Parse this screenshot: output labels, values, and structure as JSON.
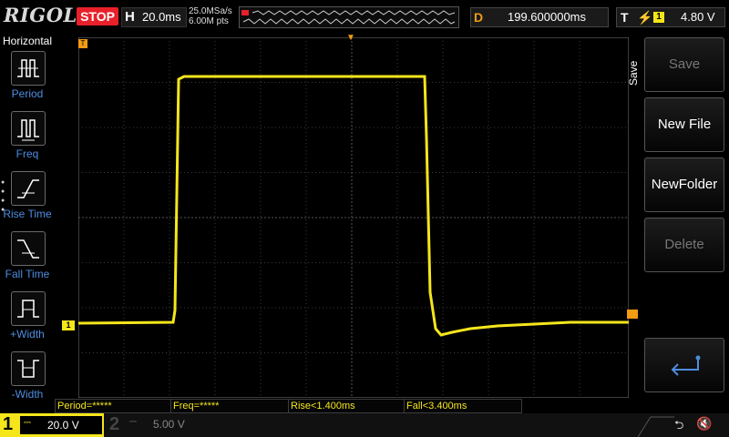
{
  "header": {
    "logo": "RIGOL",
    "run_status": "STOP",
    "timebase_letter": "H",
    "timebase": "20.0ms",
    "sample_rate": "25.0MSa/s",
    "memory_depth": "6.00M pts",
    "delay_letter": "D",
    "delay": "199.600000ms",
    "trigger_letter": "T",
    "trigger_channel": "1",
    "trigger_level": "4.80 V"
  },
  "left_menu": {
    "title": "Horizontal",
    "items": [
      {
        "label": "Period"
      },
      {
        "label": "Freq"
      },
      {
        "label": "Rise Time"
      },
      {
        "label": "Fall Time"
      },
      {
        "label": "+Width"
      },
      {
        "label": "-Width"
      }
    ],
    "dots": "●\n●\n●\n●"
  },
  "markers": {
    "trigger_position": "▼",
    "time_marker": "T",
    "channel1": "1"
  },
  "right_menu": {
    "title": "Save",
    "buttons": [
      {
        "label": "Save",
        "enabled": false
      },
      {
        "label": "New File",
        "enabled": true
      },
      {
        "label": "NewFolder",
        "enabled": true
      },
      {
        "label": "Delete",
        "enabled": false
      },
      {
        "label": "",
        "icon": "return-arrow-icon",
        "enabled": true
      }
    ]
  },
  "measurements": [
    {
      "text": "Period=*****"
    },
    {
      "text": "Freq=*****"
    },
    {
      "text": "Rise<1.400ms"
    },
    {
      "text": "Fall<3.400ms"
    }
  ],
  "bottom": {
    "ch1_number": "1",
    "ch1_scale": "20.0 V",
    "ch2_number": "2",
    "ch2_scale": "5.00 V",
    "coupling_glyph": "⎓"
  },
  "colors": {
    "ch1": "#f5e61b",
    "stop": "#e8202a",
    "trigger": "#f29c12",
    "menu_label": "#4d8dde"
  },
  "icons": {
    "usb": "usb-icon",
    "speaker_muted": "speaker-muted-icon"
  }
}
